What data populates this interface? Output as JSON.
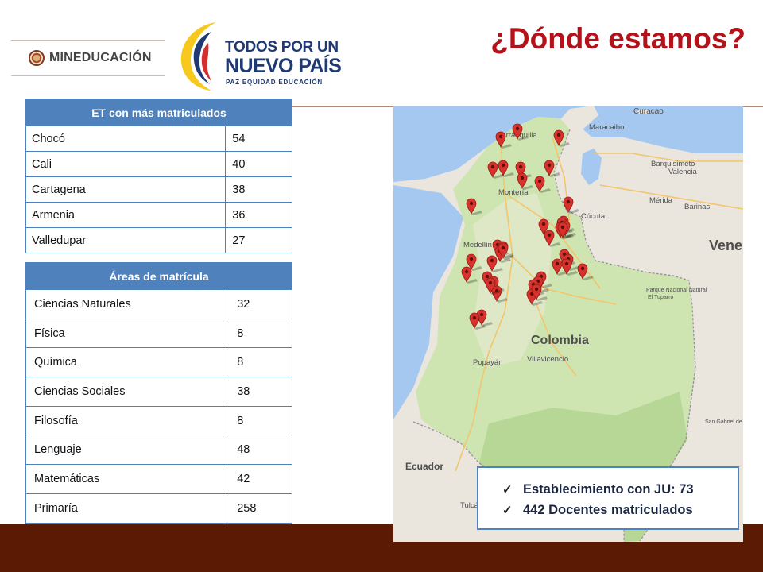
{
  "header": {
    "title": "¿Dónde estamos?",
    "ministry_logo_text": "MINEDUCACIÓN",
    "campaign_logo": {
      "line1": "TODOS POR UN",
      "line2": "NUEVO PAÍS",
      "line3": "PAZ  EQUIDAD  EDUCACIÓN"
    }
  },
  "table_top_et": {
    "header": "ET con más matriculados",
    "rows": [
      {
        "name": "Chocó",
        "value": "54"
      },
      {
        "name": "Cali",
        "value": "40"
      },
      {
        "name": "Cartagena",
        "value": "38"
      },
      {
        "name": "Armenia",
        "value": "36"
      },
      {
        "name": "Valledupar",
        "value": "27"
      }
    ]
  },
  "table_areas": {
    "header": "Áreas de matrícula",
    "rows": [
      {
        "name": "Ciencias Naturales",
        "value": "32"
      },
      {
        "name": "Física",
        "value": "8"
      },
      {
        "name": "Química",
        "value": "8"
      },
      {
        "name": "Ciencias Sociales",
        "value": "38"
      },
      {
        "name": "Filosofía",
        "value": "8"
      },
      {
        "name": "Lenguaje",
        "value": "48"
      },
      {
        "name": "Matemáticas",
        "value": "42"
      },
      {
        "name": "Primaría",
        "value": "258"
      }
    ]
  },
  "map": {
    "country_label": "Colombia",
    "neighbor_labels": {
      "venezuela": "Vene",
      "ecuador": "Ecuador",
      "curacao": "Curacao"
    },
    "city_labels": [
      "Barranquilla",
      "Maracaibo",
      "Barquisimeto",
      "Valencia",
      "Montería",
      "Mérida",
      "Barinas",
      "Cúcuta",
      "Medellín",
      "Villavicencio",
      "Popayán",
      "Tulcán"
    ],
    "park_labels": [
      "Parque Nacional Natural El Tuparro",
      "San Gabriel de Cassa"
    ],
    "marker_color": "#d9312c",
    "marker_count": 57
  },
  "stats": {
    "items": [
      "Establecimiento  con JU: 73",
      "442 Docentes matriculados"
    ]
  },
  "colors": {
    "title_red": "#b4121a",
    "table_blue": "#4f81bd",
    "footer_brown": "#5a1a04"
  }
}
